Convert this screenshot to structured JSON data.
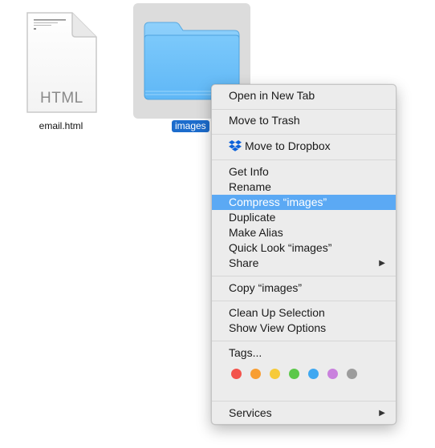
{
  "desktop": {
    "items": [
      {
        "name": "email.html",
        "type_label": "HTML",
        "selected": false
      },
      {
        "name": "images",
        "type_label": "",
        "selected": true
      }
    ]
  },
  "context_menu": {
    "groups": [
      [
        {
          "label": "Open in New Tab"
        }
      ],
      [
        {
          "label": "Move to Trash"
        }
      ],
      [
        {
          "label": "Move to Dropbox",
          "icon": "dropbox-icon"
        }
      ],
      [
        {
          "label": "Get Info"
        },
        {
          "label": "Rename"
        },
        {
          "label": "Compress “images”",
          "highlighted": true
        },
        {
          "label": "Duplicate"
        },
        {
          "label": "Make Alias"
        },
        {
          "label": "Quick Look “images”"
        },
        {
          "label": "Share",
          "submenu": true
        }
      ],
      [
        {
          "label": "Copy “images”"
        }
      ],
      [
        {
          "label": "Clean Up Selection"
        },
        {
          "label": "Show View Options"
        }
      ],
      [
        {
          "label": "Tags..."
        }
      ],
      [
        {
          "label": "Services",
          "submenu": true
        }
      ]
    ],
    "tag_colors": [
      {
        "name": "red",
        "color": "#f3534c"
      },
      {
        "name": "orange",
        "color": "#f89e32"
      },
      {
        "name": "yellow",
        "color": "#f7ca38"
      },
      {
        "name": "green",
        "color": "#5cc84a"
      },
      {
        "name": "blue",
        "color": "#3fa8f1"
      },
      {
        "name": "purple",
        "color": "#c980dd"
      },
      {
        "name": "gray",
        "color": "#9c9c9c"
      }
    ],
    "highlight_color": "#5ba9f4"
  }
}
